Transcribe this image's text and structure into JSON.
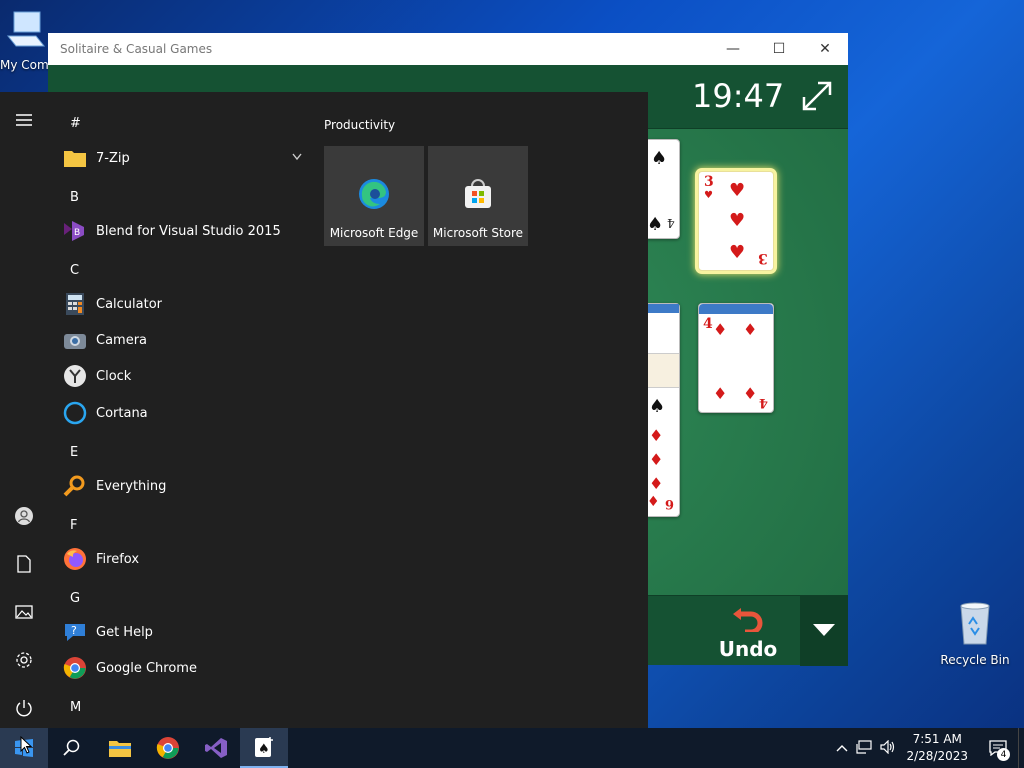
{
  "desktop": {
    "my_computer_label": "My Com",
    "recycle_bin_label": "Recycle Bin"
  },
  "solitaire": {
    "window_title": "Solitaire & Casual Games",
    "timer": "19:47",
    "undo_label": "Undo",
    "cards": {
      "three_hearts_rank": "3",
      "four_diamonds_rank": "4",
      "nine_rank": "6",
      "spade_four_rank": "4"
    }
  },
  "start_menu": {
    "groups": {
      "hash": "#",
      "b": "B",
      "c": "C",
      "e": "E",
      "f": "F",
      "g": "G",
      "m": "M"
    },
    "apps": {
      "zip": "7-Zip",
      "blend": "Blend for Visual Studio 2015",
      "calculator": "Calculator",
      "camera": "Camera",
      "clock": "Clock",
      "cortana": "Cortana",
      "everything": "Everything",
      "firefox": "Firefox",
      "gethelp": "Get Help",
      "chrome": "Google Chrome"
    },
    "tiles_header": "Productivity",
    "tiles": {
      "edge": "Microsoft Edge",
      "store": "Microsoft Store"
    }
  },
  "taskbar": {
    "time": "7:51 AM",
    "date": "2/28/2023",
    "notification_count": "4"
  },
  "colors": {
    "felt": "#226e44",
    "start_bg": "#202020",
    "taskbar_bg": "#0f1a2a"
  }
}
